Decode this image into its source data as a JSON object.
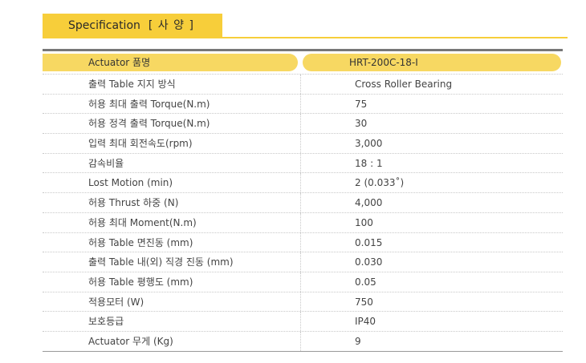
{
  "title": {
    "en": "Specification",
    "ko": "[ 사 양 ]"
  },
  "header": {
    "left": "Actuator 품명",
    "right": "HRT-200C-18-I"
  },
  "rows": [
    {
      "label": "출력 Table 지지 방식",
      "value": "Cross Roller Bearing"
    },
    {
      "label": "허용 최대 출력 Torque(N.m)",
      "value": "75"
    },
    {
      "label": "허용 정격 출력 Torque(N.m)",
      "value": "30"
    },
    {
      "label": "입력 최대 회전속도(rpm)",
      "value": "3,000"
    },
    {
      "label": "감속비율",
      "value": "18 : 1"
    },
    {
      "label": "Lost Motion (min)",
      "value": "2 (0.033˚)"
    },
    {
      "label": "허용 Thrust 하중 (N)",
      "value": "4,000"
    },
    {
      "label": "허용 최대  Moment(N.m)",
      "value": "100"
    },
    {
      "label": "허용 Table 면진동 (mm)",
      "value": "0.015"
    },
    {
      "label": "출력 Table 내(외) 직경 진동 (mm)",
      "value": "0.030"
    },
    {
      "label": "허용 Table 평행도 (mm)",
      "value": "0.05"
    },
    {
      "label": "적용모터 (W)",
      "value": "750"
    },
    {
      "label": "보호등급",
      "value": "IP40"
    },
    {
      "label": "Actuator 무게 (Kg)",
      "value": "9"
    }
  ]
}
